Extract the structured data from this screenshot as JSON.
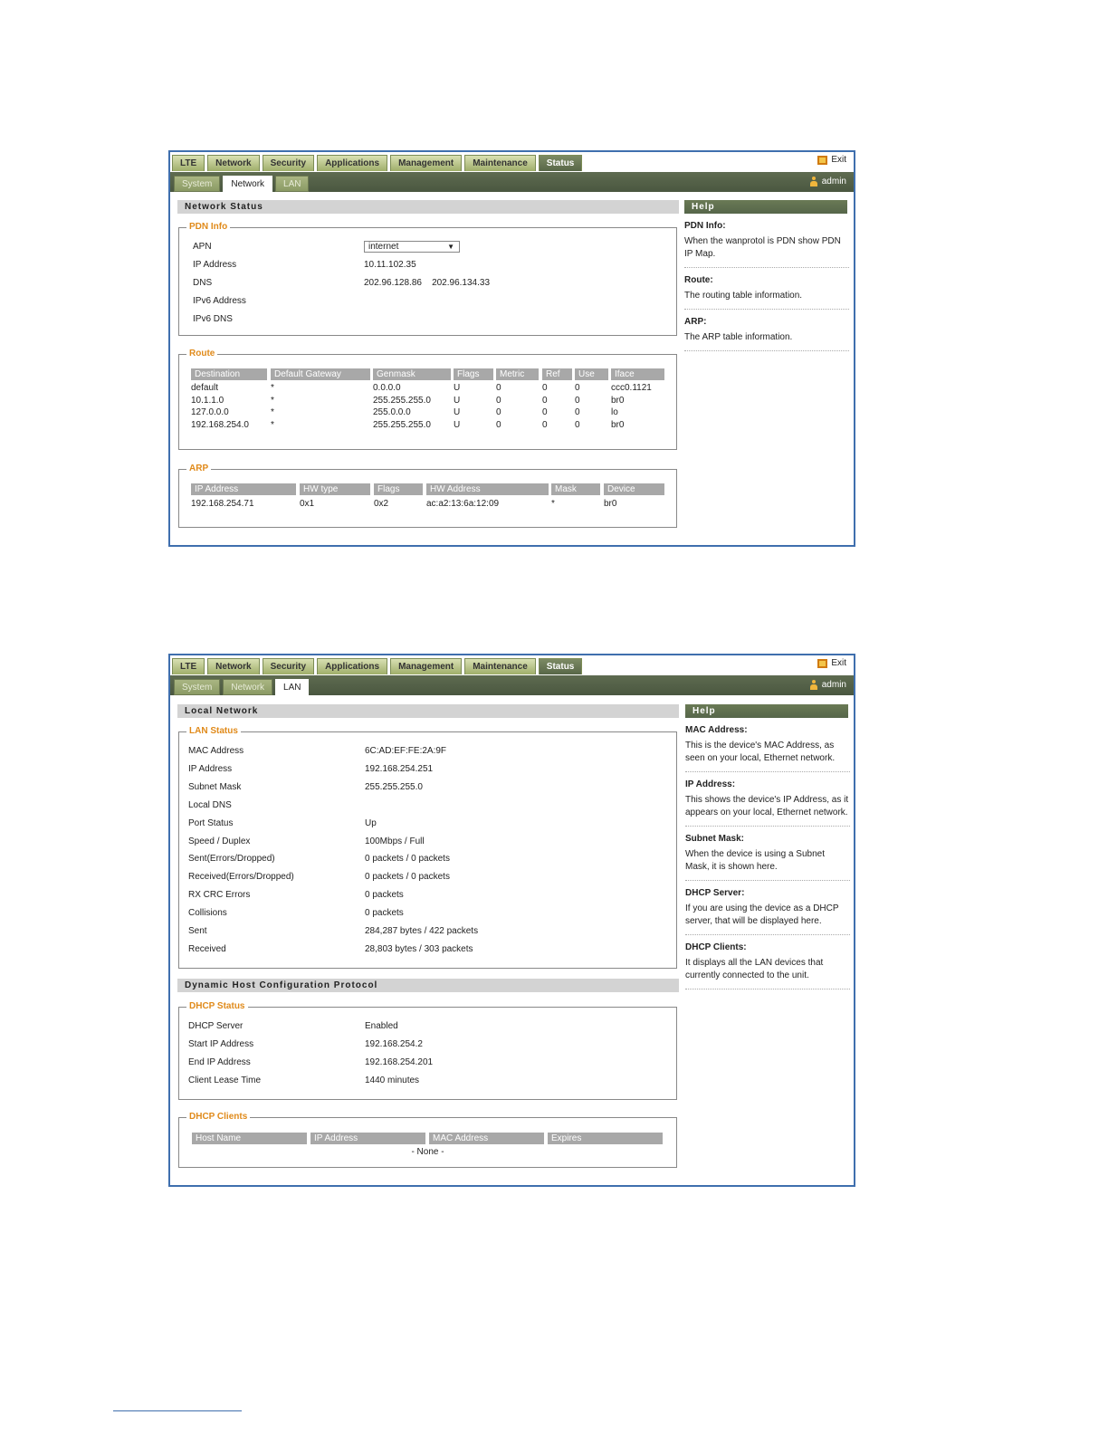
{
  "shot1": {
    "top_tabs": [
      "LTE",
      "Network",
      "Security",
      "Applications",
      "Management",
      "Maintenance",
      "Status"
    ],
    "exit_label": "Exit",
    "sub_tabs": [
      "System",
      "Network",
      "LAN"
    ],
    "user": "admin",
    "section_title": "Network Status",
    "pdn": {
      "legend": "PDN Info",
      "apn_label": "APN",
      "apn_value": "internet",
      "ip_label": "IP Address",
      "ip_value": "10.11.102.35",
      "dns_label": "DNS",
      "dns_value": "202.96.128.86    202.96.134.33",
      "ipv6_label": "IPv6 Address",
      "ipv6dns_label": "IPv6 DNS"
    },
    "route": {
      "legend": "Route",
      "headers": [
        "Destination",
        "Default Gateway",
        "Genmask",
        "Flags",
        "Metric",
        "Ref",
        "Use",
        "Iface"
      ],
      "rows": [
        [
          "default",
          "*",
          "0.0.0.0",
          "U",
          "0",
          "0",
          "0",
          "ccc0.1121"
        ],
        [
          "10.1.1.0",
          "*",
          "255.255.255.0",
          "U",
          "0",
          "0",
          "0",
          "br0"
        ],
        [
          "127.0.0.0",
          "*",
          "255.0.0.0",
          "U",
          "0",
          "0",
          "0",
          "lo"
        ],
        [
          "192.168.254.0",
          "*",
          "255.255.255.0",
          "U",
          "0",
          "0",
          "0",
          "br0"
        ]
      ]
    },
    "arp": {
      "legend": "ARP",
      "headers": [
        "IP Address",
        "HW type",
        "Flags",
        "HW Address",
        "Mask",
        "Device"
      ],
      "rows": [
        [
          "192.168.254.71",
          "0x1",
          "0x2",
          "ac:a2:13:6a:12:09",
          "*",
          "br0"
        ]
      ]
    },
    "help": {
      "title": "Help",
      "items": [
        {
          "title": "PDN Info:",
          "desc": "When the wanprotol is PDN show PDN IP Map."
        },
        {
          "title": "Route:",
          "desc": "The routing table information."
        },
        {
          "title": "ARP:",
          "desc": "The ARP table information."
        }
      ]
    }
  },
  "shot2": {
    "top_tabs": [
      "LTE",
      "Network",
      "Security",
      "Applications",
      "Management",
      "Maintenance",
      "Status"
    ],
    "exit_label": "Exit",
    "sub_tabs": [
      "System",
      "Network",
      "LAN"
    ],
    "user": "admin",
    "section_title": "Local Network",
    "lan": {
      "legend": "LAN Status",
      "rows": [
        [
          "MAC Address",
          "6C:AD:EF:FE:2A:9F"
        ],
        [
          "IP Address",
          "192.168.254.251"
        ],
        [
          "Subnet Mask",
          "255.255.255.0"
        ],
        [
          "Local DNS",
          ""
        ],
        [
          "Port Status",
          "Up"
        ],
        [
          "Speed / Duplex",
          "100Mbps / Full"
        ],
        [
          "Sent(Errors/Dropped)",
          "0 packets / 0 packets"
        ],
        [
          "Received(Errors/Dropped)",
          "0 packets / 0 packets"
        ],
        [
          "RX CRC Errors",
          "0 packets"
        ],
        [
          "Collisions",
          "0 packets"
        ],
        [
          "Sent",
          "284,287 bytes / 422 packets"
        ],
        [
          "Received",
          "28,803 bytes / 303 packets"
        ]
      ]
    },
    "dhcp_section_title": "Dynamic Host Configuration Protocol",
    "dhcp_status": {
      "legend": "DHCP Status",
      "rows": [
        [
          "DHCP Server",
          "Enabled"
        ],
        [
          "Start IP Address",
          "192.168.254.2"
        ],
        [
          "End IP Address",
          "192.168.254.201"
        ],
        [
          "Client Lease Time",
          "1440 minutes"
        ]
      ]
    },
    "dhcp_clients": {
      "legend": "DHCP Clients",
      "headers": [
        "Host Name",
        "IP Address",
        "MAC Address",
        "Expires"
      ],
      "empty": "- None -"
    },
    "help": {
      "title": "Help",
      "items": [
        {
          "title": "MAC Address:",
          "desc": "This is the device's MAC Address, as seen on your local, Ethernet network."
        },
        {
          "title": "IP Address:",
          "desc": "This shows the device's IP Address, as it appears on your local, Ethernet network."
        },
        {
          "title": "Subnet Mask:",
          "desc": "When the device is using a Subnet Mask, it is shown here."
        },
        {
          "title": "DHCP Server:",
          "desc": "If you are using the device as a DHCP server, that will be displayed here."
        },
        {
          "title": "DHCP Clients:",
          "desc": "It displays all the LAN devices that currently connected to the unit."
        }
      ]
    }
  }
}
